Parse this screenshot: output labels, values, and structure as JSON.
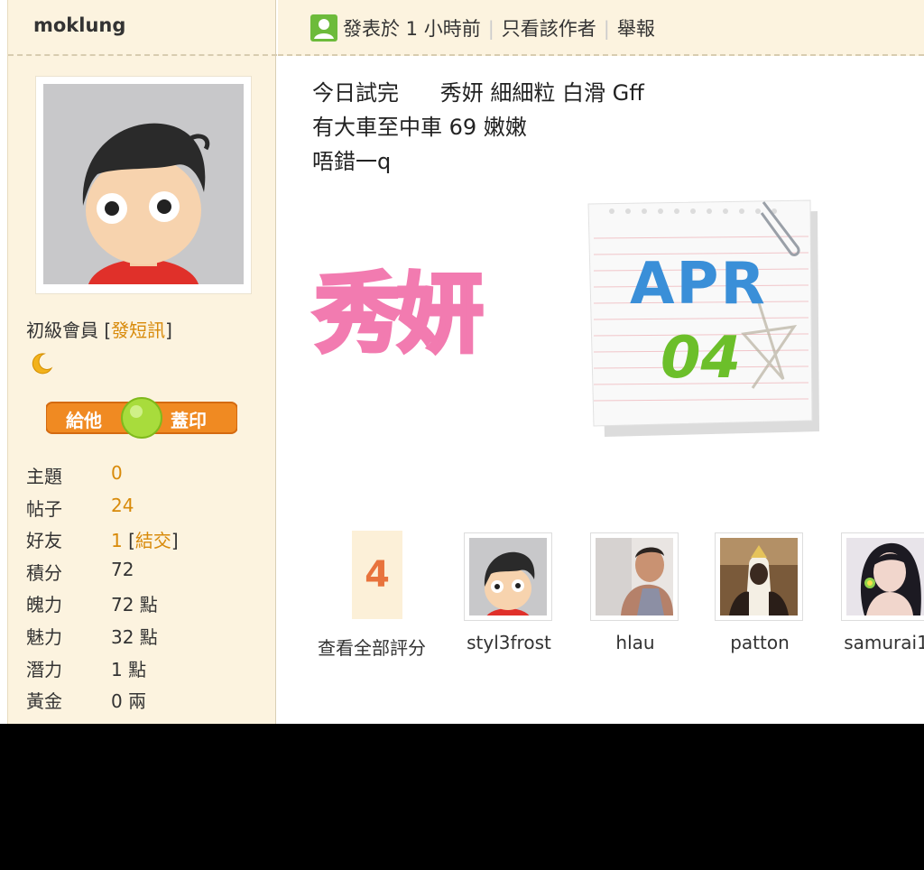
{
  "sidebar": {
    "username": "moklung",
    "rank": "初級會員",
    "send_pm_label": "發短訊",
    "stamp_button": {
      "left": "給他",
      "right": "蓋印"
    },
    "stats": [
      {
        "label": "主題",
        "value": "0",
        "link": true
      },
      {
        "label": "帖子",
        "value": "24",
        "link": true
      },
      {
        "label": "好友",
        "value": "1",
        "link": true,
        "extra": "結交"
      },
      {
        "label": "積分",
        "value": "72"
      },
      {
        "label": "魄力",
        "value": "72 點"
      },
      {
        "label": "魅力",
        "value": "32 點"
      },
      {
        "label": "潛力",
        "value": "1 點"
      },
      {
        "label": "黃金",
        "value": "0 兩"
      }
    ]
  },
  "post_header": {
    "posted": "發表於 1 小時前",
    "author_only": "只看該作者",
    "report": "舉報"
  },
  "post": {
    "lines": [
      "今日試完      秀妍 細細粒 白滑 Gff",
      "有大車至中車 69 嫩嫩",
      "唔錯一q"
    ],
    "title_art": "秀妍",
    "note": {
      "month": "APR",
      "day": "04"
    }
  },
  "ratings": {
    "count": "4",
    "view_all": "查看全部評分",
    "raters": [
      "styl3frost",
      "hlau",
      "patton",
      "samurai1"
    ]
  },
  "colors": {
    "link": "#d88a0a",
    "sidebar_bg": "#fcf3df",
    "title_art": "#f27bb0"
  }
}
